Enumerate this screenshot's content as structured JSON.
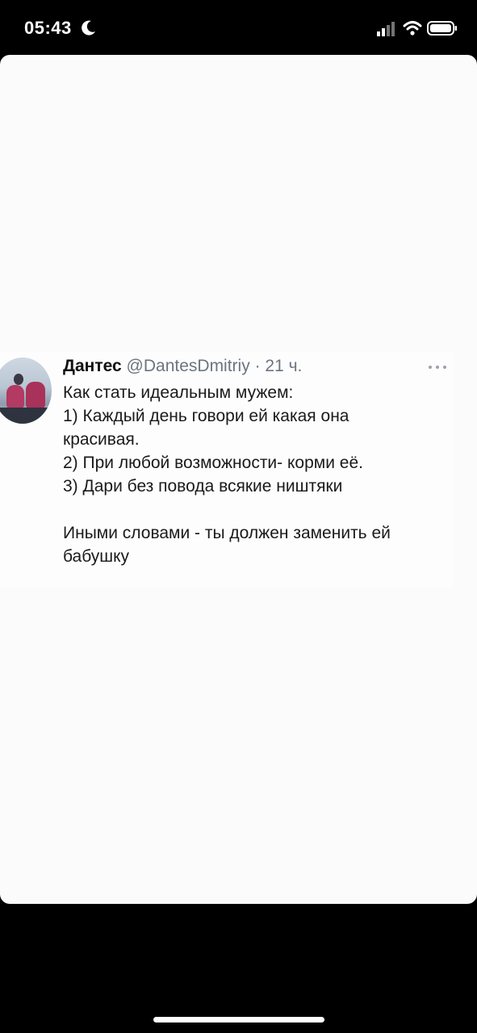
{
  "status_bar": {
    "time": "05:43",
    "focus_icon": "moon-icon",
    "signal_icon": "signal-icon",
    "wifi_icon": "wifi-icon",
    "battery_icon": "battery-icon"
  },
  "tweet": {
    "author_name": "Дантес",
    "author_handle": "@DantesDmitriy",
    "separator": "·",
    "time": "21 ч.",
    "more_icon": "more-horizontal-icon",
    "lines": [
      "Как стать идеальным мужем:",
      "1) Каждый день говори ей какая она",
      "красивая.",
      "2) При любой возможности- корми её.",
      "3) Дари без повода всякие ништяки",
      "",
      "Иными словами - ты должен заменить ей",
      "бабушку"
    ]
  },
  "colors": {
    "screen_background": "#fbfbfb",
    "frame_background": "#000000",
    "text_primary": "#111111",
    "text_secondary": "#6b7580"
  }
}
